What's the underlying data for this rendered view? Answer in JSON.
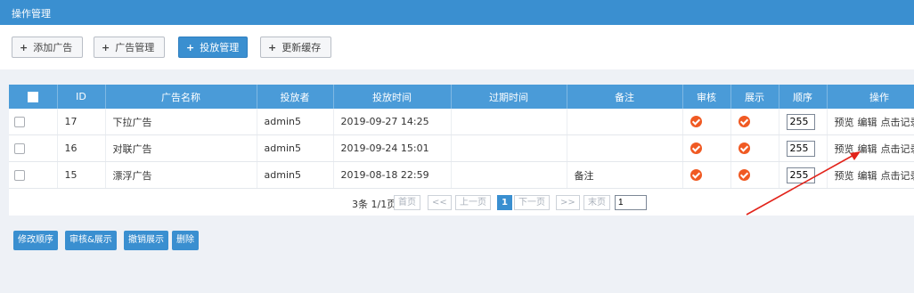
{
  "title": "操作管理",
  "toolbar": [
    {
      "label": "添加广告",
      "active": false
    },
    {
      "label": "广告管理",
      "active": false
    },
    {
      "label": "投放管理",
      "active": true
    },
    {
      "label": "更新缓存",
      "active": false
    }
  ],
  "columns": [
    "ID",
    "广告名称",
    "投放者",
    "投放时间",
    "过期时间",
    "备注",
    "审核",
    "展示",
    "顺序",
    "操作"
  ],
  "rows": [
    {
      "id": "17",
      "name": "下拉广告",
      "user": "admin5",
      "start": "2019-09-27 14:25",
      "expire": "",
      "note": "",
      "audit": true,
      "show": true,
      "order": "255"
    },
    {
      "id": "16",
      "name": "对联广告",
      "user": "admin5",
      "start": "2019-09-24 15:01",
      "expire": "",
      "note": "",
      "audit": true,
      "show": true,
      "order": "255"
    },
    {
      "id": "15",
      "name": "漂浮广告",
      "user": "admin5",
      "start": "2019-08-18 22:59",
      "expire": "",
      "note": "备注",
      "audit": true,
      "show": true,
      "order": "255"
    }
  ],
  "row_actions": [
    "预览",
    "编辑",
    "点击记录"
  ],
  "pagination": {
    "info": "3条 1/1页",
    "first": "首页",
    "prev_arrow": "<<",
    "prev": "上一页",
    "current": "1",
    "next": "下一页",
    "next_arrow": ">>",
    "last": "末页",
    "jump_value": "1"
  },
  "bottom_buttons": [
    "修改顺序",
    "审核&展示",
    "撤销展示",
    "删除"
  ],
  "colors": {
    "primary": "#3a8fd0",
    "header": "#4a9bd8",
    "ok": "#f05a23",
    "annotation": "#e2231a"
  }
}
